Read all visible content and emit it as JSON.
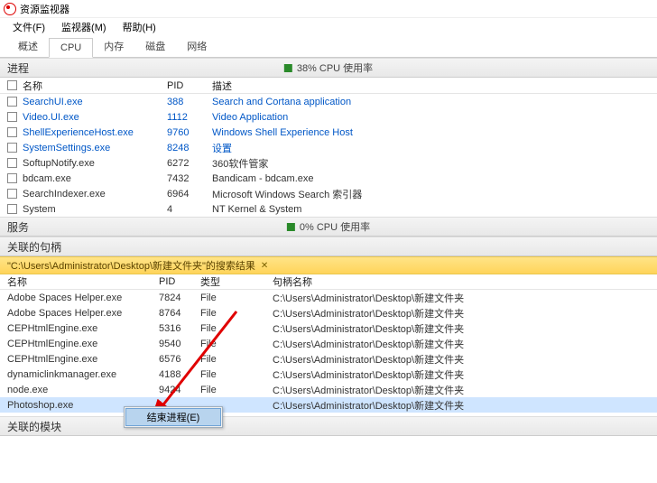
{
  "window": {
    "title": "资源监视器"
  },
  "menu": {
    "file": "文件(F)",
    "monitor": "监视器(M)",
    "help": "帮助(H)"
  },
  "tabs": {
    "overview": "概述",
    "cpu": "CPU",
    "memory": "内存",
    "disk": "磁盘",
    "network": "网络"
  },
  "processes": {
    "title": "进程",
    "status": "38% CPU 使用率",
    "cols": {
      "name": "名称",
      "pid": "PID",
      "desc": "描述"
    },
    "rows": [
      {
        "name": "SearchUI.exe",
        "pid": "388",
        "desc": "Search and Cortana application",
        "link": true
      },
      {
        "name": "Video.UI.exe",
        "pid": "1112",
        "desc": "Video Application",
        "link": true
      },
      {
        "name": "ShellExperienceHost.exe",
        "pid": "9760",
        "desc": "Windows Shell Experience Host",
        "link": true
      },
      {
        "name": "SystemSettings.exe",
        "pid": "8248",
        "desc": "设置",
        "link": true
      },
      {
        "name": "SoftupNotify.exe",
        "pid": "6272",
        "desc": "360软件管家",
        "link": false
      },
      {
        "name": "bdcam.exe",
        "pid": "7432",
        "desc": "Bandicam - bdcam.exe",
        "link": false
      },
      {
        "name": "SearchIndexer.exe",
        "pid": "6964",
        "desc": "Microsoft Windows Search 索引器",
        "link": false
      },
      {
        "name": "System",
        "pid": "4",
        "desc": "NT Kernel & System",
        "link": false
      }
    ]
  },
  "services": {
    "title": "服务",
    "status": "0% CPU 使用率"
  },
  "handles_section": {
    "title": "关联的句柄"
  },
  "search": {
    "text": "\"C:\\Users\\Administrator\\Desktop\\新建文件夹\"的搜索结果"
  },
  "handles": {
    "cols": {
      "name": "名称",
      "pid": "PID",
      "type": "类型",
      "hname": "句柄名称"
    },
    "rows": [
      {
        "name": "Adobe Spaces Helper.exe",
        "pid": "7824",
        "type": "File",
        "hname": "C:\\Users\\Administrator\\Desktop\\新建文件夹"
      },
      {
        "name": "Adobe Spaces Helper.exe",
        "pid": "8764",
        "type": "File",
        "hname": "C:\\Users\\Administrator\\Desktop\\新建文件夹"
      },
      {
        "name": "CEPHtmlEngine.exe",
        "pid": "5316",
        "type": "File",
        "hname": "C:\\Users\\Administrator\\Desktop\\新建文件夹"
      },
      {
        "name": "CEPHtmlEngine.exe",
        "pid": "9540",
        "type": "File",
        "hname": "C:\\Users\\Administrator\\Desktop\\新建文件夹"
      },
      {
        "name": "CEPHtmlEngine.exe",
        "pid": "6576",
        "type": "File",
        "hname": "C:\\Users\\Administrator\\Desktop\\新建文件夹"
      },
      {
        "name": "dynamiclinkmanager.exe",
        "pid": "4188",
        "type": "File",
        "hname": "C:\\Users\\Administrator\\Desktop\\新建文件夹"
      },
      {
        "name": "node.exe",
        "pid": "9424",
        "type": "File",
        "hname": "C:\\Users\\Administrator\\Desktop\\新建文件夹"
      },
      {
        "name": "Photoshop.exe",
        "pid": "",
        "type": "",
        "hname": "C:\\Users\\Administrator\\Desktop\\新建文件夹",
        "selected": true
      }
    ]
  },
  "context_menu": {
    "end_process": "结束进程(E)"
  },
  "modules_section": {
    "title": "关联的模块"
  }
}
